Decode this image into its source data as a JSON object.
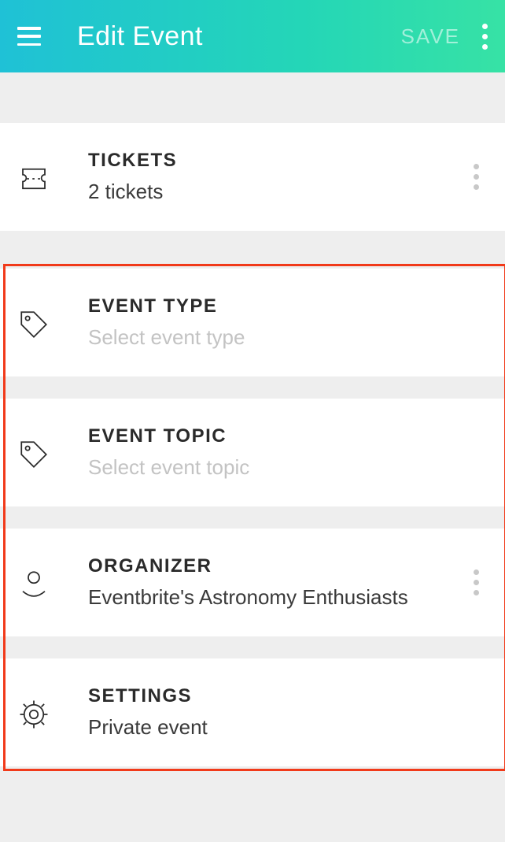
{
  "header": {
    "title": "Edit Event",
    "save_label": "SAVE"
  },
  "tickets": {
    "label": "TICKETS",
    "value": "2 tickets"
  },
  "event_type": {
    "label": "EVENT TYPE",
    "placeholder": "Select event type"
  },
  "event_topic": {
    "label": "EVENT TOPIC",
    "placeholder": "Select event topic"
  },
  "organizer": {
    "label": "ORGANIZER",
    "value": "Eventbrite's Astronomy Enthusiasts"
  },
  "settings": {
    "label": "SETTINGS",
    "value": "Private event"
  }
}
